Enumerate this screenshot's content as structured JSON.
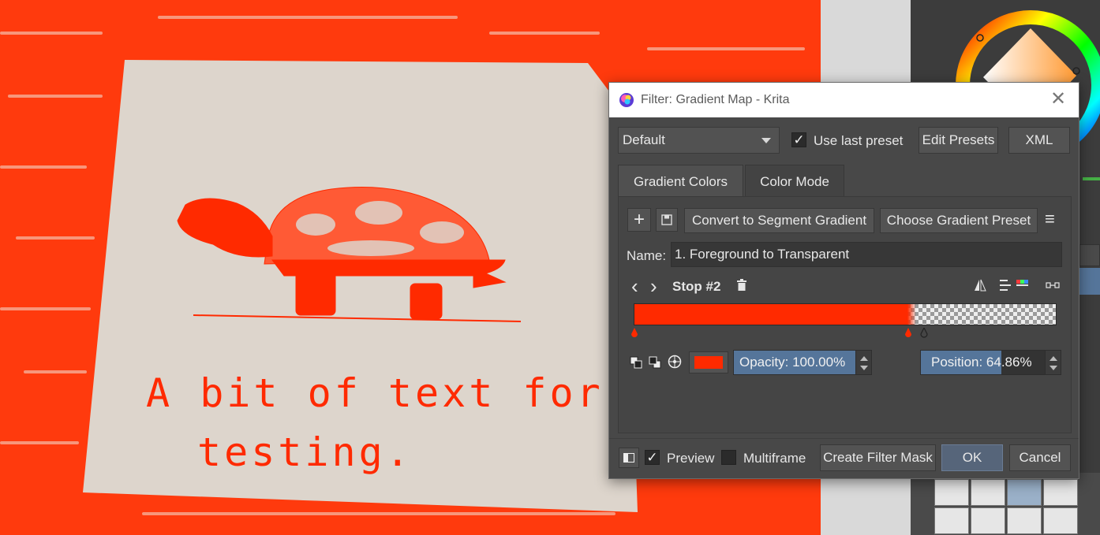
{
  "window": {
    "title": "Filter: Gradient Map - Krita",
    "close_glyph": "✕"
  },
  "canvas": {
    "handwriting_line1": "A bit of text for",
    "handwriting_line2": "testing."
  },
  "toolbar": {
    "preset_value": "Default",
    "use_last_preset_label": "Use last preset",
    "use_last_preset_checked": true,
    "edit_presets_label": "Edit Presets",
    "xml_label": "XML"
  },
  "tabs": [
    {
      "label": "Gradient Colors",
      "active": true
    },
    {
      "label": "Color Mode",
      "active": false
    }
  ],
  "gradient_toolbar": {
    "add_glyph": "+",
    "convert_label": "Convert to Segment Gradient",
    "choose_preset_label": "Choose Gradient Preset",
    "menu_glyph": "≡"
  },
  "name_row": {
    "label": "Name:",
    "value": "1. Foreground to Transparent"
  },
  "stop_row": {
    "prev_glyph": "‹",
    "next_glyph": "›",
    "stop_label": "Stop #2"
  },
  "gradient": {
    "start_color": "#ff2a00",
    "stop_positions_percent": [
      0,
      64.86
    ],
    "end": "transparent"
  },
  "stop_editor": {
    "color_swatch": "#ff2a00",
    "opacity_text": "Opacity: 100.00%",
    "opacity_value": 100.0,
    "position_text": "Position: 64.86%",
    "position_value": 64.86
  },
  "footer": {
    "preview_label": "Preview",
    "preview_checked": true,
    "multiframe_label": "Multiframe",
    "multiframe_checked": false,
    "create_mask_label": "Create Filter Mask",
    "ok_label": "OK",
    "cancel_label": "Cancel"
  },
  "colors": {
    "canvas_orange": "#ff3a0d",
    "accent_blue": "#55759a",
    "dialog_bg": "#484848"
  }
}
